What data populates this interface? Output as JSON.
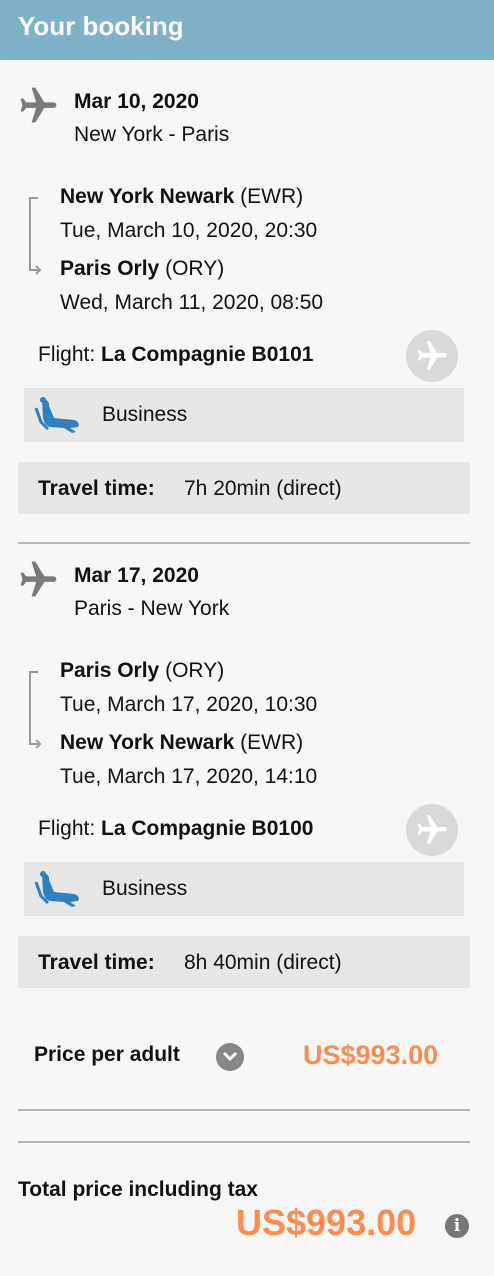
{
  "header": {
    "title": "Your booking"
  },
  "segments": [
    {
      "date": "Mar 10, 2020",
      "route": "New York - Paris",
      "departure": {
        "airport_name": "New York Newark",
        "airport_code": "(EWR)",
        "datetime": "Tue, March 10, 2020, 20:30"
      },
      "arrival": {
        "airport_name": "Paris Orly",
        "airport_code": "(ORY)",
        "datetime": "Wed, March 11, 2020, 08:50"
      },
      "flight_label": "Flight:",
      "flight_number": "La Compagnie B0101",
      "cabin": "Business",
      "travel_time_label": "Travel time:",
      "travel_time_value": "7h 20min (direct)"
    },
    {
      "date": "Mar 17, 2020",
      "route": "Paris - New York",
      "departure": {
        "airport_name": "Paris Orly",
        "airport_code": "(ORY)",
        "datetime": "Tue, March 17, 2020, 10:30"
      },
      "arrival": {
        "airport_name": "New York Newark",
        "airport_code": "(EWR)",
        "datetime": "Tue, March 17, 2020, 14:10"
      },
      "flight_label": "Flight:",
      "flight_number": "La Compagnie B0100",
      "cabin": "Business",
      "travel_time_label": "Travel time:",
      "travel_time_value": "8h 40min (direct)"
    }
  ],
  "price": {
    "label": "Price per adult",
    "value": "US$993.00",
    "icon": "chevron-down-icon"
  },
  "total": {
    "label": "Total price including tax",
    "value": "US$993.00",
    "icon": "info-icon"
  },
  "colors": {
    "header_bg": "#7fb1c9",
    "price_accent": "#fd8c4e",
    "seat_icon": "#2f7fc1",
    "box_bg": "#e6e6e6"
  }
}
